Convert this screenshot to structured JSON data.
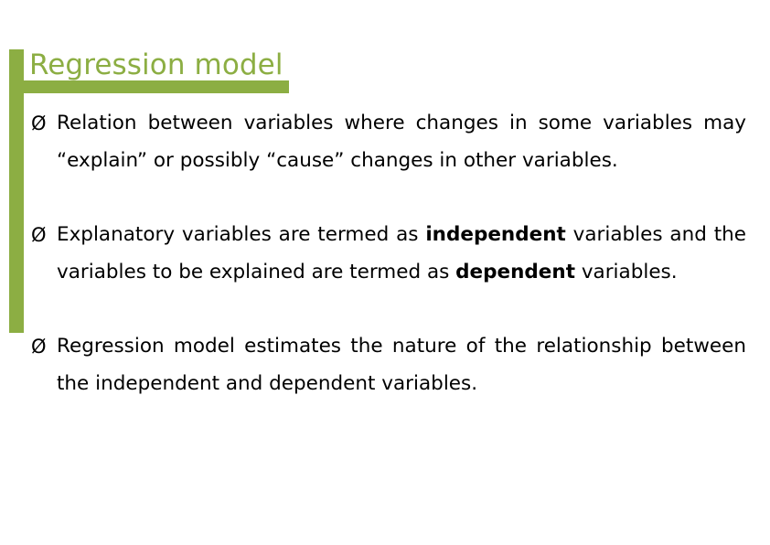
{
  "slide": {
    "title": "Regression model",
    "accent_color": "#8cae43",
    "text_color": "#000000",
    "background_color": "#ffffff",
    "bullet_glyph": "Ø",
    "bullets": [
      {
        "id": "bullet-relation",
        "segments": [
          {
            "text": "Relation between variables where changes in some variables may “explain” or possibly “cause” changes in other variables.",
            "bold": false
          }
        ]
      },
      {
        "id": "bullet-explanatory",
        "segments": [
          {
            "text": "Explanatory variables are termed as ",
            "bold": false
          },
          {
            "text": "independent",
            "bold": true
          },
          {
            "text": " variables and the variables to be explained are termed as ",
            "bold": false
          },
          {
            "text": "dependent",
            "bold": true
          },
          {
            "text": " variables.",
            "bold": false
          }
        ]
      },
      {
        "id": "bullet-estimates",
        "segments": [
          {
            "text": "Regression model estimates the nature of the relationship between the independent and dependent variables.",
            "bold": false
          }
        ]
      }
    ]
  }
}
